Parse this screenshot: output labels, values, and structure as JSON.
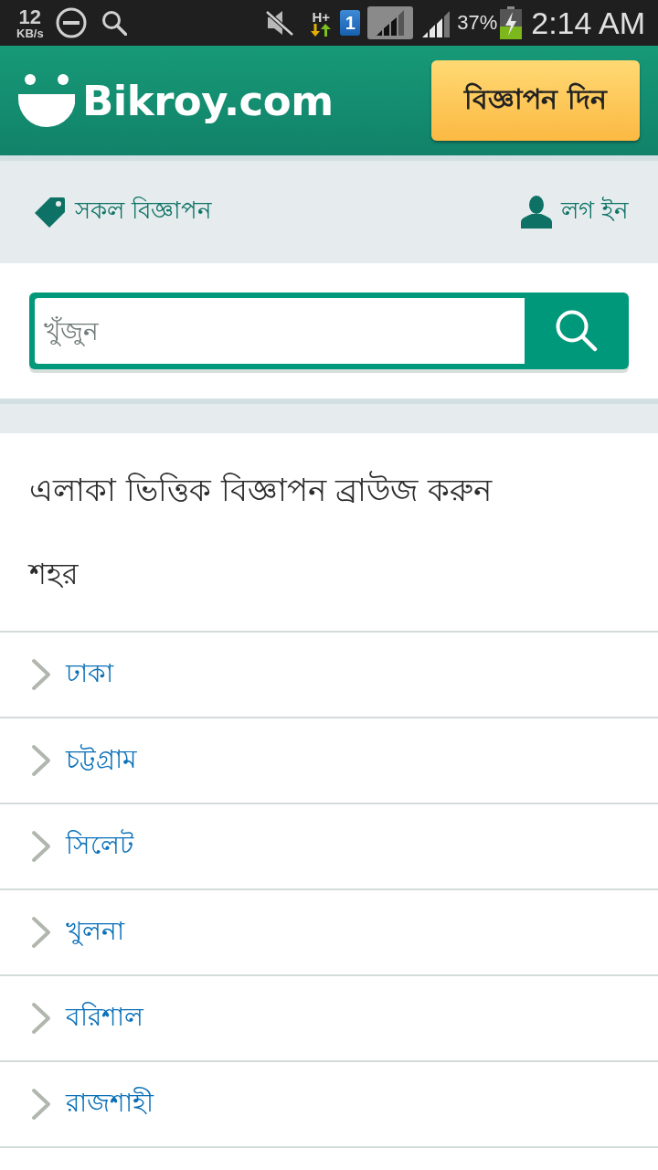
{
  "status_bar": {
    "speed_value": "12",
    "speed_unit": "KB/s",
    "network_type": "H+",
    "sim_slot": "1",
    "battery_percent": "37%",
    "time": "2:14 AM"
  },
  "header": {
    "logo_text": "Bikroy.com",
    "post_ad_button": "বিজ্ঞাপন দিন"
  },
  "nav": {
    "all_ads": "সকল বিজ্ঞাপন",
    "login": "লগ ইন"
  },
  "search": {
    "placeholder": "খুঁজুন"
  },
  "browse": {
    "title": "এলাকা ভিত্তিক বিজ্ঞাপন ব্রাউজ করুন",
    "section_label": "শহর",
    "cities": [
      "ঢাকা",
      "চট্টগ্রাম",
      "সিলেট",
      "খুলনা",
      "বরিশাল",
      "রাজশাহী"
    ]
  }
}
